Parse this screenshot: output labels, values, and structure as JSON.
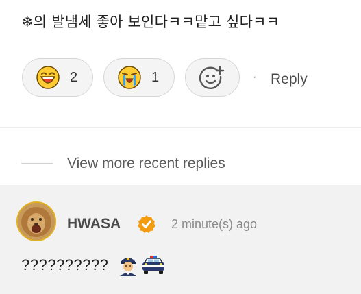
{
  "comment": {
    "text": "❄의 발냄세 좋아 보인다ㅋㅋ맡고 싶다ㅋㅋ",
    "reactions": [
      {
        "icon": "laughing-face-icon",
        "count": "2"
      },
      {
        "icon": "crying-face-icon",
        "count": "1"
      }
    ],
    "add_reaction_icon": "add-reaction-icon",
    "separator": "·",
    "reply_label": "Reply"
  },
  "view_more": {
    "label": "View more recent replies"
  },
  "reply": {
    "author": "HWASA",
    "time": "2 minute(s) ago",
    "text": "??????????",
    "emojis": [
      "police-officer-icon",
      "police-car-icon"
    ],
    "verified_color": "#f39c12"
  }
}
